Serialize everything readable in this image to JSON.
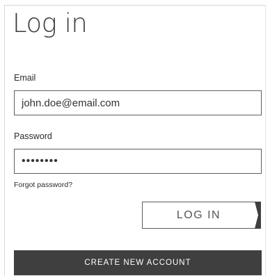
{
  "form": {
    "title": "Log in",
    "email": {
      "label": "Email",
      "value": "john.doe@email.com"
    },
    "password": {
      "label": "Password",
      "masked_value": "••••••••"
    },
    "forgot_link": "Forgot password?",
    "login_button": "LOG IN",
    "create_account_button": "CREATE NEW ACCOUNT"
  },
  "colors": {
    "text": "#333333",
    "border": "#5d5d5d",
    "dark_button": "#3f3f3f",
    "panel_border": "#d6d6d6"
  }
}
